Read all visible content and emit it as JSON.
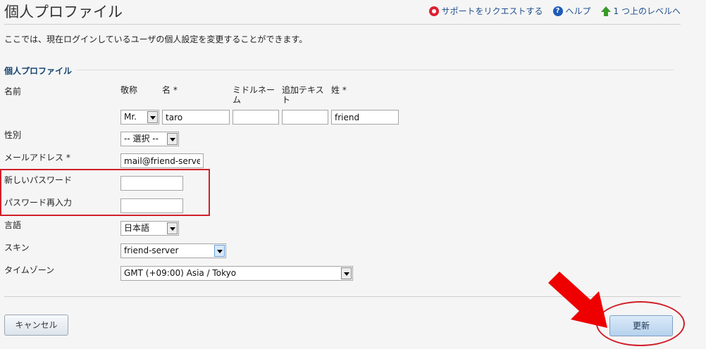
{
  "header": {
    "title": "個人プロファイル",
    "links": {
      "support": "サポートをリクエストする",
      "help": "ヘルプ",
      "up": "1 つ上のレベルへ"
    }
  },
  "intro": "ここでは、現在ログインしているユーザの個人設定を変更することができます。",
  "section_title": "個人プロファイル",
  "name": {
    "label": "名前",
    "honorific_label": "敬称",
    "first_label": "名 *",
    "middle_label": "ミドルネーム",
    "suffix_label": "追加テキスト",
    "last_label": "姓 *",
    "honorific_value": "Mr.",
    "first_value": "taro",
    "middle_value": "",
    "suffix_value": "",
    "last_value": "friend"
  },
  "gender": {
    "label": "性別",
    "value": "-- 選択 --"
  },
  "email": {
    "label": "メールアドレス *",
    "value": "mail@friend-server"
  },
  "new_password": {
    "label": "新しいパスワード",
    "value": ""
  },
  "confirm_password": {
    "label": "パスワード再入力",
    "value": ""
  },
  "language": {
    "label": "言語",
    "value": "日本語"
  },
  "skin": {
    "label": "スキン",
    "value": "friend-server"
  },
  "timezone": {
    "label": "タイムゾーン",
    "value": "GMT (+09:00) Asia / Tokyo"
  },
  "buttons": {
    "cancel": "キャンセル",
    "update": "更新"
  },
  "annotation_color": "#d0202a"
}
